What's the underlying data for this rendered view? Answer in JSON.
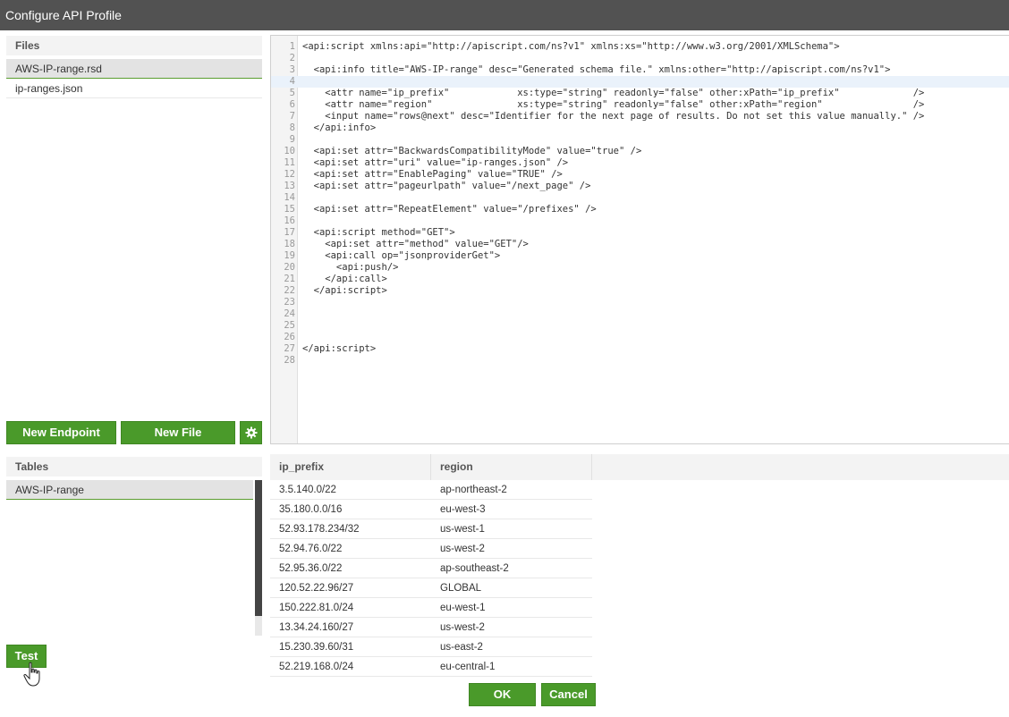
{
  "window": {
    "title": "Configure API Profile"
  },
  "files": {
    "header": "Files",
    "items": [
      "AWS-IP-range.rsd",
      "ip-ranges.json"
    ],
    "selected_index": 0
  },
  "toolbar": {
    "new_endpoint_label": "New Endpoint",
    "new_file_label": "New File",
    "settings_icon": "gear-icon"
  },
  "editor": {
    "active_line": 4,
    "lines": [
      "<api:script xmlns:api=\"http://apiscript.com/ns?v1\" xmlns:xs=\"http://www.w3.org/2001/XMLSchema\">",
      "",
      "  <api:info title=\"AWS-IP-range\" desc=\"Generated schema file.\" xmlns:other=\"http://apiscript.com/ns?v1\">",
      "",
      "    <attr name=\"ip_prefix\"            xs:type=\"string\" readonly=\"false\" other:xPath=\"ip_prefix\"             />",
      "    <attr name=\"region\"               xs:type=\"string\" readonly=\"false\" other:xPath=\"region\"                />",
      "    <input name=\"rows@next\" desc=\"Identifier for the next page of results. Do not set this value manually.\" />",
      "  </api:info>",
      "",
      "  <api:set attr=\"BackwardsCompatibilityMode\" value=\"true\" />",
      "  <api:set attr=\"uri\" value=\"ip-ranges.json\" />",
      "  <api:set attr=\"EnablePaging\" value=\"TRUE\" />",
      "  <api:set attr=\"pageurlpath\" value=\"/next_page\" />",
      "",
      "  <api:set attr=\"RepeatElement\" value=\"/prefixes\" />",
      "",
      "  <api:script method=\"GET\">",
      "    <api:set attr=\"method\" value=\"GET\"/>",
      "    <api:call op=\"jsonproviderGet\">",
      "      <api:push/>",
      "    </api:call>",
      "  </api:script>",
      "",
      "",
      "",
      "",
      "</api:script>",
      ""
    ]
  },
  "tables": {
    "header": "Tables",
    "items": [
      "AWS-IP-range"
    ]
  },
  "test": {
    "label": "Test"
  },
  "results": {
    "columns": [
      "ip_prefix",
      "region"
    ],
    "rows": [
      [
        "3.5.140.0/22",
        "ap-northeast-2"
      ],
      [
        "35.180.0.0/16",
        "eu-west-3"
      ],
      [
        "52.93.178.234/32",
        "us-west-1"
      ],
      [
        "52.94.76.0/22",
        "us-west-2"
      ],
      [
        "52.95.36.0/22",
        "ap-southeast-2"
      ],
      [
        "120.52.22.96/27",
        "GLOBAL"
      ],
      [
        "150.222.81.0/24",
        "eu-west-1"
      ],
      [
        "13.34.24.160/27",
        "us-west-2"
      ],
      [
        "15.230.39.60/31",
        "us-east-2"
      ],
      [
        "52.219.168.0/24",
        "eu-central-1"
      ]
    ]
  },
  "dialog": {
    "ok_label": "OK",
    "cancel_label": "Cancel"
  }
}
